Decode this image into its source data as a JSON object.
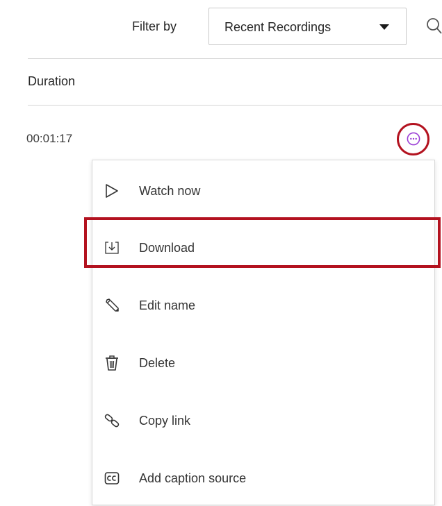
{
  "toolbar": {
    "filter_label": "Filter by",
    "filter_select": {
      "value": "Recent Recordings",
      "icon": "caret-down-icon"
    },
    "search_icon": "search-icon"
  },
  "table": {
    "columns": [
      "Duration"
    ],
    "rows": [
      {
        "duration": "00:01:17",
        "menu_icon": "more-options-icon"
      }
    ]
  },
  "row_menu": {
    "items": [
      {
        "label": "Watch now",
        "icon": "play-icon"
      },
      {
        "label": "Download",
        "icon": "download-icon",
        "highlighted": true
      },
      {
        "label": "Edit name",
        "icon": "pencil-icon"
      },
      {
        "label": "Delete",
        "icon": "trash-icon"
      },
      {
        "label": "Copy link",
        "icon": "link-icon"
      },
      {
        "label": "Add caption source",
        "icon": "closed-caption-icon"
      }
    ]
  },
  "colors": {
    "highlight": "#b3121f",
    "more_button": "#9b3fd6",
    "divider": "#d4d4d4"
  }
}
